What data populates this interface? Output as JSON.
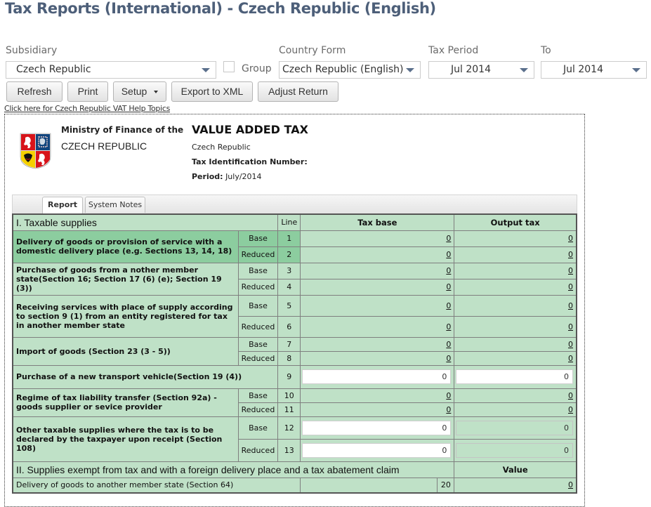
{
  "page": {
    "title": "Tax Reports (International) - Czech Republic (English)"
  },
  "filters": {
    "subsidiary": {
      "label": "Subsidiary",
      "value": "Czech Republic"
    },
    "group": {
      "label": "Group",
      "checked": false
    },
    "country_form": {
      "label": "Country Form",
      "value": "Czech Republic (English)"
    },
    "tax_period": {
      "label": "Tax Period",
      "value": "Jul 2014"
    },
    "to": {
      "label": "To",
      "value": "Jul 2014"
    }
  },
  "toolbar": {
    "refresh": "Refresh",
    "print": "Print",
    "setup": "Setup",
    "export": "Export to XML",
    "adjust": "Adjust Return"
  },
  "help_link": "Click here for Czech Republic VAT Help Topics",
  "report_header": {
    "ministry_line1": "Ministry of Finance of the",
    "ministry_line2": "CZECH REPUBLIC",
    "title": "VALUE ADDED TAX",
    "country": "Czech Republic",
    "tin_label": "Tax Identification Number:",
    "tin_value": "",
    "period_label": "Period:",
    "period_value": "July/2014",
    "crest_icon": "czech-coat-of-arms"
  },
  "tabs": [
    {
      "label": "Report",
      "active": true
    },
    {
      "label": "System Notes",
      "active": false
    }
  ],
  "section1": {
    "title": "I. Taxable supplies",
    "col_line": "Line",
    "col_tax_base": "Tax base",
    "col_output_tax": "Output tax",
    "rows": [
      {
        "desc": "Delivery of goods or provision of service with a domestic delivery place (e.g. Sections 13, 14, 18)",
        "lines": [
          {
            "sub": "Base",
            "no": "1",
            "tax_base": "0",
            "output_tax": "0"
          },
          {
            "sub": "Reduced",
            "no": "2",
            "tax_base": "0",
            "output_tax": "0"
          }
        ]
      },
      {
        "desc": "Purchase of goods from a nother member state(Section 16; Section 17 (6) (e); Section 19 (3))",
        "lines": [
          {
            "sub": "Base",
            "no": "3",
            "tax_base": "0",
            "output_tax": "0"
          },
          {
            "sub": "Reduced",
            "no": "4",
            "tax_base": "0",
            "output_tax": "0"
          }
        ]
      },
      {
        "desc": "Receiving services with place of supply according to section 9 (1) from an entity registered for tax in another member state",
        "lines": [
          {
            "sub": "Base",
            "no": "5",
            "tax_base": "0",
            "output_tax": "0"
          },
          {
            "sub": "Reduced",
            "no": "6",
            "tax_base": "0",
            "output_tax": "0"
          }
        ]
      },
      {
        "desc": "Import of goods (Section 23 (3 - 5))",
        "lines": [
          {
            "sub": "Base",
            "no": "7",
            "tax_base": "0",
            "output_tax": "0"
          },
          {
            "sub": "Reduced",
            "no": "8",
            "tax_base": "0",
            "output_tax": "0"
          }
        ]
      },
      {
        "desc": "Purchase of a new transport vehicle(Section 19 (4))",
        "lines": [
          {
            "sub": "",
            "no": "9",
            "tax_base": "0",
            "output_tax": "0"
          }
        ]
      },
      {
        "desc": "Regime of tax liability transfer (Section 92a) - goods supplier or sevice provider",
        "lines": [
          {
            "sub": "Base",
            "no": "10",
            "tax_base": "0",
            "output_tax": "0"
          },
          {
            "sub": "Reduced",
            "no": "11",
            "tax_base": "0",
            "output_tax": "0"
          }
        ]
      },
      {
        "desc": "Other taxable supplies where the tax is to be declared by the taxpayer upon receipt (Section 108)",
        "lines": [
          {
            "sub": "Base",
            "no": "12",
            "tax_base": "0",
            "output_tax": "0"
          },
          {
            "sub": "Reduced",
            "no": "13",
            "tax_base": "0",
            "output_tax": "0"
          }
        ]
      }
    ]
  },
  "section2": {
    "title": "II. Supplies exempt from tax and with a foreign delivery place and a tax abatement claim",
    "col_value": "Value",
    "rows": [
      {
        "desc": "Delivery of goods to another member state (Section 64)",
        "no": "20",
        "value": "0"
      }
    ]
  }
}
